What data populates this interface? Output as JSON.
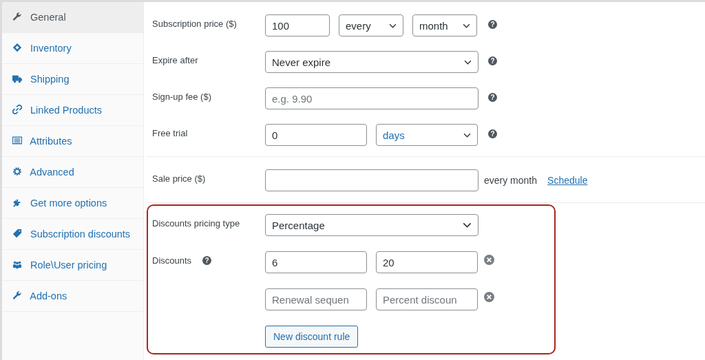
{
  "sidebar": {
    "items": [
      {
        "label": "General",
        "selected": true
      },
      {
        "label": "Inventory",
        "selected": false
      },
      {
        "label": "Shipping",
        "selected": false
      },
      {
        "label": "Linked Products",
        "selected": false
      },
      {
        "label": "Attributes",
        "selected": false
      },
      {
        "label": "Advanced",
        "selected": false
      },
      {
        "label": "Get more options",
        "selected": false
      },
      {
        "label": "Subscription discounts",
        "selected": false
      },
      {
        "label": "Role\\User pricing",
        "selected": false
      },
      {
        "label": "Add-ons",
        "selected": false
      }
    ]
  },
  "fields": [
    {
      "kind": "price",
      "label": "Subscription price ($)",
      "value": "100",
      "interval": "every",
      "period": "month",
      "help": "?"
    },
    {
      "kind": "select",
      "label": "Expire after",
      "value": "Never expire",
      "help": "?"
    },
    {
      "kind": "input",
      "label": "Sign-up fee ($)",
      "placeholder": "e.g. 9.90",
      "help": "?"
    },
    {
      "kind": "trial",
      "label": "Free trial",
      "value": "0",
      "unit": "days",
      "help": "?"
    }
  ],
  "sale": {
    "label": "Sale price ($)",
    "suffix": "every month",
    "link": "Schedule"
  },
  "discounts": {
    "pricing_type_label": "Discounts pricing type",
    "pricing_type": "Percentage",
    "label": "Discounts",
    "help": "?",
    "rules": [
      {
        "sequence": {
          "value": "6"
        },
        "percent": {
          "value": "20"
        }
      },
      {
        "sequence": {
          "placeholder": "Renewal sequen"
        },
        "percent": {
          "placeholder": "Percent discoun"
        }
      }
    ],
    "button": "New discount rule"
  }
}
